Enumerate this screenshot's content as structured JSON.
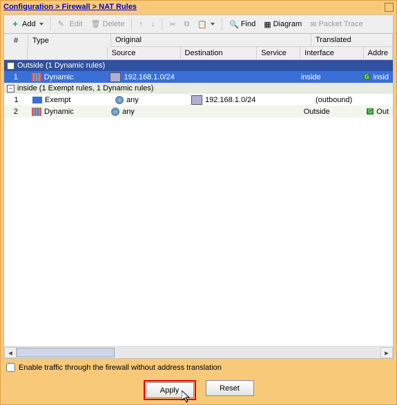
{
  "breadcrumb": "Configuration > Firewall > NAT Rules",
  "toolbar": {
    "add": "Add",
    "edit": "Edit",
    "delete": "Delete",
    "find": "Find",
    "diagram": "Diagram",
    "trace": "Packet Trace"
  },
  "headers": {
    "num": "#",
    "type": "Type",
    "original": "Original",
    "source": "Source",
    "destination": "Destination",
    "service": "Service",
    "translated": "Translated",
    "interface": "Interface",
    "address": "Addre"
  },
  "groups": {
    "outside": "Outside (1 Dynamic rules)",
    "inside": "inside (1 Exempt rules, 1 Dynamic rules)"
  },
  "rows": {
    "r1": {
      "num": "1",
      "type": "Dynamic",
      "src": "192.168.1.0/24",
      "dst": "",
      "svc": "",
      "int": "inside",
      "addr": "insid"
    },
    "r2": {
      "num": "1",
      "type": "Exempt",
      "src": "any",
      "dst": "192.168.1.0/24",
      "svc": "",
      "int": "(outbound)",
      "addr": ""
    },
    "r3": {
      "num": "2",
      "type": "Dynamic",
      "src": "any",
      "dst": "",
      "svc": "",
      "int": "Outside",
      "addr": "Out"
    }
  },
  "checkbox": "Enable traffic through the firewall without address translation",
  "buttons": {
    "apply": "Apply",
    "reset": "Reset"
  }
}
